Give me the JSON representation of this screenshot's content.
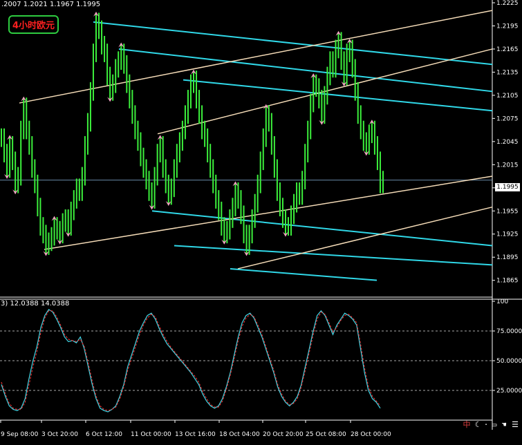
{
  "chart_data": [
    {
      "type": "line",
      "header": ".2007 1.2021 1.1967 1.1995",
      "symbol_label": "4小时欧元",
      "ylim": [
        1.1845,
        1.2225
      ],
      "y_ticks": [
        "1.2225",
        "1.2195",
        "1.2165",
        "1.2135",
        "1.2105",
        "1.2075",
        "1.2045",
        "1.2015",
        "1.1985",
        "1.1955",
        "1.1925",
        "1.1895",
        "1.1865"
      ],
      "last_price": "1.1995",
      "series": [
        {
          "color": "#3cf03c",
          "values": [
            1.205,
            1.203,
            1.201,
            1.204,
            1.202,
            1.199,
            1.2,
            1.206,
            1.209,
            1.206,
            1.204,
            1.201,
            1.199,
            1.196,
            1.1935,
            1.1925,
            1.191,
            1.1915,
            1.1922,
            1.1935,
            1.193,
            1.1925,
            1.194,
            1.1945,
            1.1935,
            1.1955,
            1.197,
            1.1985,
            1.198,
            1.2,
            1.204,
            1.207,
            1.211,
            1.216,
            1.22,
            1.219,
            1.217,
            1.216,
            1.213,
            1.211,
            1.212,
            1.214,
            1.215,
            1.216,
            1.2145,
            1.212,
            1.21,
            1.208,
            1.206,
            1.2045,
            1.2025,
            1.201,
            1.1995,
            1.198,
            1.197,
            1.2,
            1.203,
            1.204,
            1.201,
            1.199,
            1.1975,
            1.1985,
            1.201,
            1.203,
            1.2045,
            1.206,
            1.208,
            1.21,
            1.212,
            1.2125,
            1.21,
            1.208,
            1.206,
            1.205,
            1.203,
            1.201,
            1.199,
            1.197,
            1.1955,
            1.1935,
            1.1925,
            1.193,
            1.1945,
            1.196,
            1.198,
            1.197,
            1.195,
            1.1925,
            1.191,
            1.1925,
            1.1945,
            1.1965,
            1.199,
            1.202,
            1.205,
            1.208,
            1.207,
            1.204,
            1.201,
            1.198,
            1.196,
            1.1945,
            1.1935,
            1.1935,
            1.195,
            1.1965,
            1.198,
            1.1975,
            1.1995,
            1.203,
            1.206,
            1.2095,
            1.212,
            1.2115,
            1.21,
            1.208,
            1.2105,
            1.213,
            1.215,
            1.214,
            1.2165,
            1.2175,
            1.215,
            1.213,
            1.216,
            1.2165,
            1.214,
            1.211,
            1.208,
            1.206,
            1.2045,
            1.204,
            1.2055,
            1.206,
            1.204,
            1.202,
            1.199,
            1.1995
          ]
        }
      ],
      "channels_cyan": [
        [
          [
            1.22,
            1.2145
          ]
        ],
        [
          [
            1.2165,
            1.211
          ]
        ],
        [
          [
            1.2125,
            1.2085
          ]
        ],
        [
          [
            1.1955,
            1.191
          ]
        ],
        [
          [
            1.191,
            1.1885
          ]
        ],
        [
          [
            1.188,
            1.1865
          ]
        ]
      ],
      "channels_cream": [
        [
          [
            1.2095,
            1.2215
          ]
        ],
        [
          [
            1.2055,
            1.2165
          ]
        ],
        [
          [
            1.1905,
            1.2
          ]
        ],
        [
          [
            1.188,
            1.196
          ]
        ]
      ]
    },
    {
      "type": "line",
      "header": "3)  12.0388  14.0388",
      "ylim": [
        0,
        100
      ],
      "y_ticks": [
        "100",
        "75.0000",
        "50.0000",
        "25.0000"
      ],
      "series": [
        {
          "color": "#40d8e8",
          "values": [
            30,
            20,
            12,
            9,
            8,
            10,
            18,
            35,
            50,
            62,
            78,
            88,
            93,
            91,
            85,
            78,
            70,
            66,
            67,
            65,
            70,
            60,
            45,
            30,
            18,
            10,
            8,
            7,
            9,
            12,
            20,
            30,
            45,
            55,
            65,
            75,
            82,
            88,
            90,
            85,
            77,
            70,
            64,
            60,
            56,
            52,
            48,
            44,
            40,
            35,
            30,
            22,
            16,
            12,
            10,
            12,
            18,
            28,
            40,
            55,
            70,
            82,
            88,
            90,
            86,
            78,
            70,
            60,
            50,
            40,
            28,
            20,
            15,
            12,
            15,
            20,
            30,
            45,
            60,
            75,
            88,
            92,
            88,
            80,
            72,
            80,
            85,
            90,
            88,
            85,
            80,
            60,
            40,
            25,
            18,
            15,
            10
          ]
        },
        {
          "color": "#e03030",
          "values": [
            32,
            22,
            14,
            10,
            9,
            9,
            15,
            30,
            45,
            58,
            74,
            86,
            92,
            92,
            87,
            80,
            72,
            68,
            67,
            66,
            68,
            62,
            48,
            33,
            20,
            12,
            9,
            8,
            9,
            11,
            18,
            28,
            42,
            52,
            62,
            72,
            80,
            86,
            89,
            87,
            79,
            72,
            66,
            61,
            57,
            53,
            49,
            45,
            41,
            37,
            32,
            24,
            18,
            13,
            11,
            11,
            16,
            26,
            38,
            52,
            67,
            79,
            86,
            89,
            87,
            80,
            72,
            62,
            52,
            42,
            30,
            22,
            16,
            13,
            14,
            18,
            28,
            42,
            57,
            72,
            85,
            91,
            89,
            82,
            74,
            78,
            84,
            88,
            89,
            86,
            82,
            64,
            44,
            28,
            20,
            16,
            12
          ]
        }
      ],
      "x_ticks": [
        "9 Sep 08:00",
        "3 Oct 20:00",
        "6 Oct 12:00",
        "11 Oct 00:00",
        "13 Oct 16:00",
        "18 Oct 04:00",
        "20 Oct 20:00",
        "25 Oct 08:00",
        "28 Oct 00:00"
      ]
    }
  ]
}
